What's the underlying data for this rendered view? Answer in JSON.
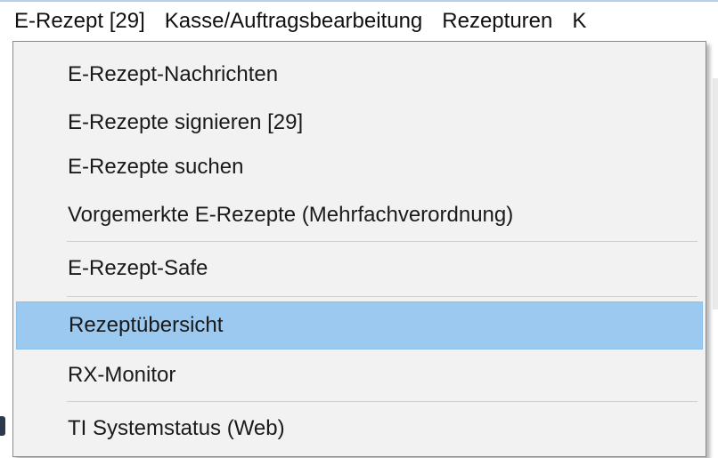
{
  "menubar": {
    "items": [
      {
        "label": "E-Rezept [29]",
        "open": true
      },
      {
        "label": "Kasse/Auftragsbearbeitung",
        "open": false
      },
      {
        "label": "Rezepturen",
        "open": false
      },
      {
        "label": "K",
        "open": false
      }
    ]
  },
  "dropdown": {
    "items": [
      {
        "label": "E-Rezept-Nachrichten"
      },
      {
        "label": "E-Rezepte signieren [29]"
      },
      {
        "label": "E-Rezepte suchen"
      },
      {
        "label": "Vorgemerkte E-Rezepte (Mehrfachverordnung)"
      },
      {
        "label": "E-Rezept-Safe"
      },
      {
        "label": "Rezeptübersicht",
        "highlighted": true
      },
      {
        "label": "RX-Monitor"
      },
      {
        "label": "TI Systemstatus (Web)"
      }
    ]
  },
  "colors": {
    "highlight": "#9cc9ef",
    "menu_background": "#f2f2f2",
    "separator": "#cfcfcf"
  }
}
